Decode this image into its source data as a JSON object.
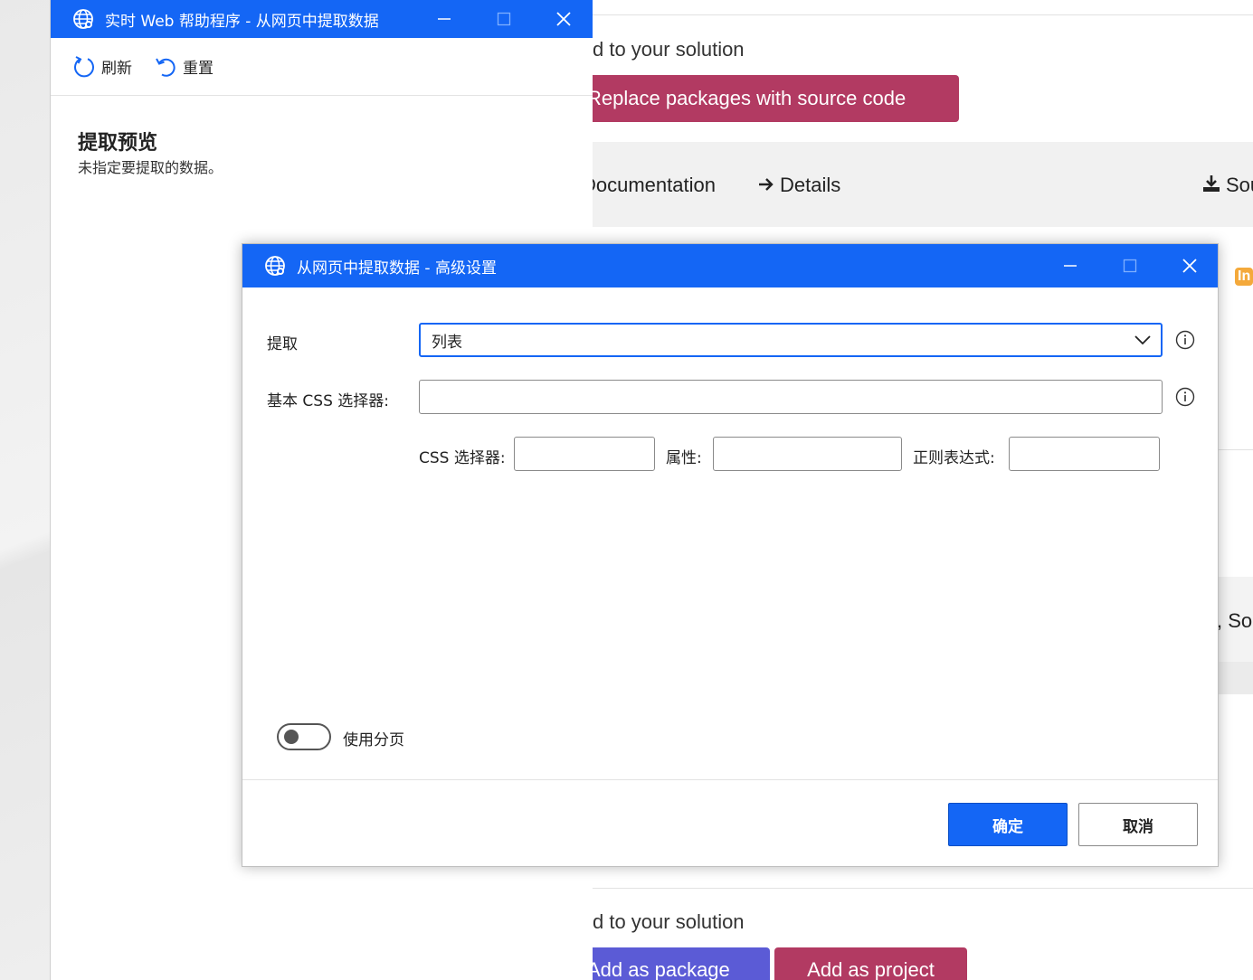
{
  "background_page": {
    "line1": "d to your solution",
    "replace_btn": "Replace packages with source code",
    "nav_documentation": "Documentation",
    "nav_details": "Details",
    "nav_source": "Sou",
    "badge": "In",
    "source2": ", Sou",
    "line2": "d to your solution",
    "add_package": "Add as package",
    "add_project": "Add as project"
  },
  "helper_window": {
    "title": "实时 Web 帮助程序 - 从网页中提取数据",
    "refresh_label": "刷新",
    "reset_label": "重置",
    "preview_title": "提取预览",
    "preview_subtitle": "未指定要提取的数据。"
  },
  "dialog": {
    "title": "从网页中提取数据 - 高级设置",
    "extract_label": "提取",
    "extract_value": "列表",
    "base_css_label": "基本 CSS 选择器:",
    "base_css_value": "",
    "css_selector_label": "CSS 选择器:",
    "css_selector_value": "",
    "attribute_label": "属性:",
    "attribute_value": "",
    "regex_label": "正则表达式:",
    "regex_value": "",
    "pagination_label": "使用分页",
    "ok_label": "确定",
    "cancel_label": "取消"
  },
  "colors": {
    "accent": "#1466f5",
    "replace_button": "#b23a62",
    "package_button": "#5b5bd6",
    "badge": "#f4a93b"
  }
}
